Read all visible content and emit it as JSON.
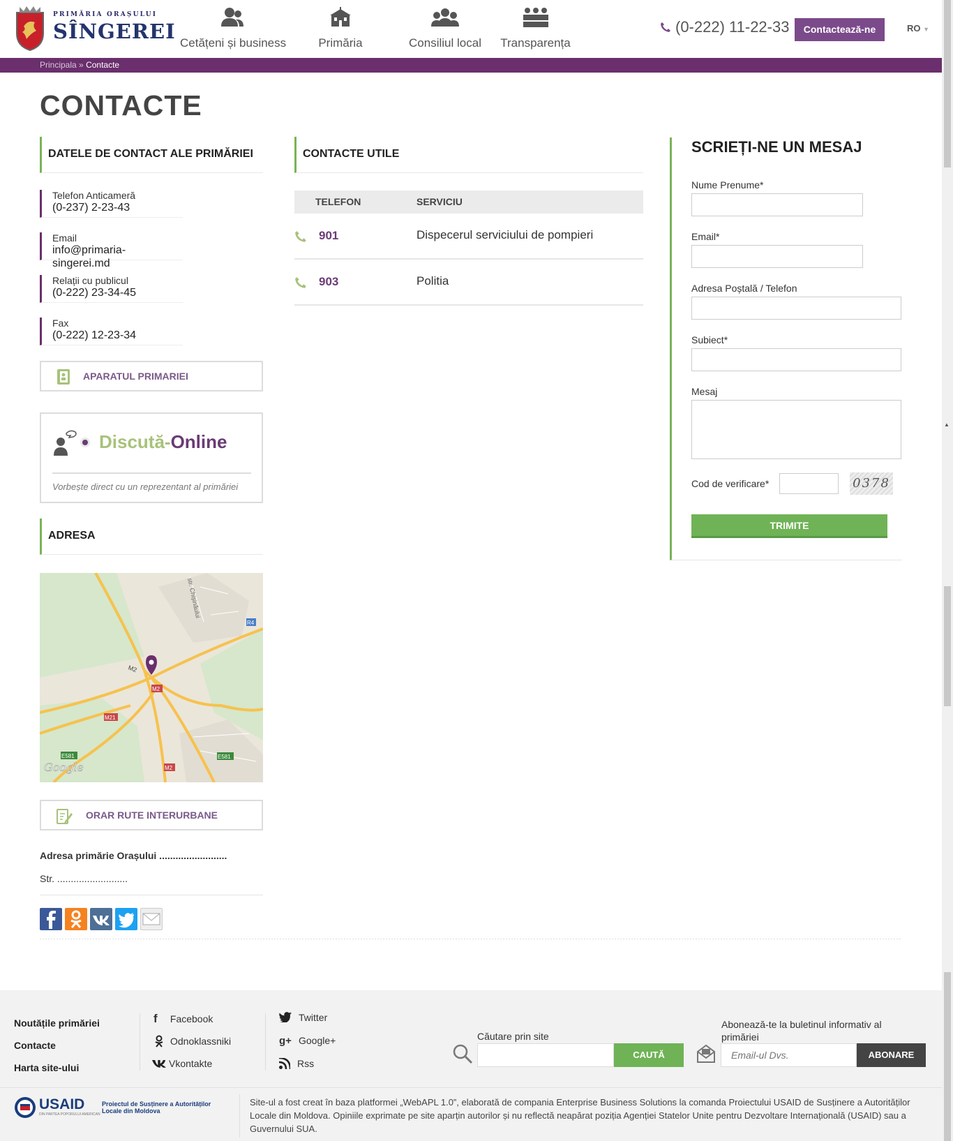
{
  "header": {
    "logo_top": "PRIMĂRIA ORAȘULUI",
    "logo_name": "SÎNGEREI",
    "nav": [
      {
        "label": "Cetățeni și business",
        "icon": "users-icon"
      },
      {
        "label": "Primăria",
        "icon": "school-building-icon"
      },
      {
        "label": "Consiliul local",
        "icon": "group-icon"
      },
      {
        "label": "Transparența",
        "icon": "council-table-icon"
      }
    ],
    "phone": "(0-222) 11-22-33",
    "contact_button": "Contactează-ne",
    "lang": "RO"
  },
  "breadcrumb": {
    "home": "Principala",
    "sep": "»",
    "current": "Contacte"
  },
  "page_title": "CONTACTE",
  "left": {
    "section_title": "DATELE DE CONTACT ALE PRIMĂRIEI",
    "contacts": [
      {
        "label": "Telefon Anticameră",
        "value": "(0-237) 2-23-43"
      },
      {
        "label": "Email",
        "value": "info@primaria-singerei.md"
      },
      {
        "label": "Relații cu publicul",
        "value": "(0-222) 23-34-45"
      },
      {
        "label": "Fax",
        "value": "(0-222) 12-23-34"
      }
    ],
    "aparat_button": "APARATUL PRIMARIEI",
    "chat": {
      "title_part1": "Discută-",
      "title_part2": "Online",
      "subtitle": "Vorbește direct cu un reprezentant al primăriei"
    },
    "address_title": "ADRESA",
    "map_labels": {
      "street": "str. Chișinăului",
      "r4": "R4",
      "m2": "M2",
      "m21": "M21",
      "e581": "E581",
      "google": "Google"
    },
    "orar_button": "ORAR RUTE INTERURBANE",
    "address_line1": "Adresa primărie Orașului .........................",
    "address_line2": "Str. .........................."
  },
  "middle": {
    "section_title": "CONTACTE UTILE",
    "col_phone": "TELEFON",
    "col_service": "SERVICIU",
    "rows": [
      {
        "phone": "901",
        "service": "Dispecerul serviciului de pompieri"
      },
      {
        "phone": "903",
        "service": "Politia"
      }
    ]
  },
  "form": {
    "title": "SCRIEȚI-NE UN MESAJ",
    "name_label": "Nume Prenume*",
    "email_label": "Email*",
    "address_label": "Adresa Poștală / Telefon",
    "subject_label": "Subiect*",
    "message_label": "Mesaj",
    "captcha_label": "Cod de verificare*",
    "captcha_text": "0378",
    "submit": "TRIMITE"
  },
  "footer": {
    "links": [
      "Noutățile primăriei",
      "Contacte",
      "Harta site-ului"
    ],
    "social_col1": [
      "Facebook",
      "Odnoklassniki",
      "Vkontakte"
    ],
    "social_col2": [
      "Twitter",
      "Google+",
      "Rss"
    ],
    "search_label": "Căutare prin site",
    "search_button": "CAUTĂ",
    "newsletter_label": "Abonează-te la buletinul informativ al primăriei",
    "newsletter_placeholder": "Email-ul Dvs.",
    "newsletter_button": "ABONARE",
    "usaid": "USAID",
    "usaid_sub": "DIN PARTEA POPORULUI AMERICAN",
    "project": "Proiectul de Susținere a Autorităților Locale din Moldova",
    "note": "Site-ul a fost creat în baza platformei „WebAPL 1.0”, elaborată de compania Enterprise Business Solutions la comanda Proiectului USAID de Susținere a Autorităților Locale din Moldova. Opiniile exprimate pe site aparțin autorilor și nu reflectă neapărat poziția Agenției Statelor Unite pentru Dezvoltare Internațională (USAID) sau a Guvernului SUA."
  },
  "colors": {
    "brand_purple": "#6a2f6c",
    "accent_green": "#6fb356"
  }
}
